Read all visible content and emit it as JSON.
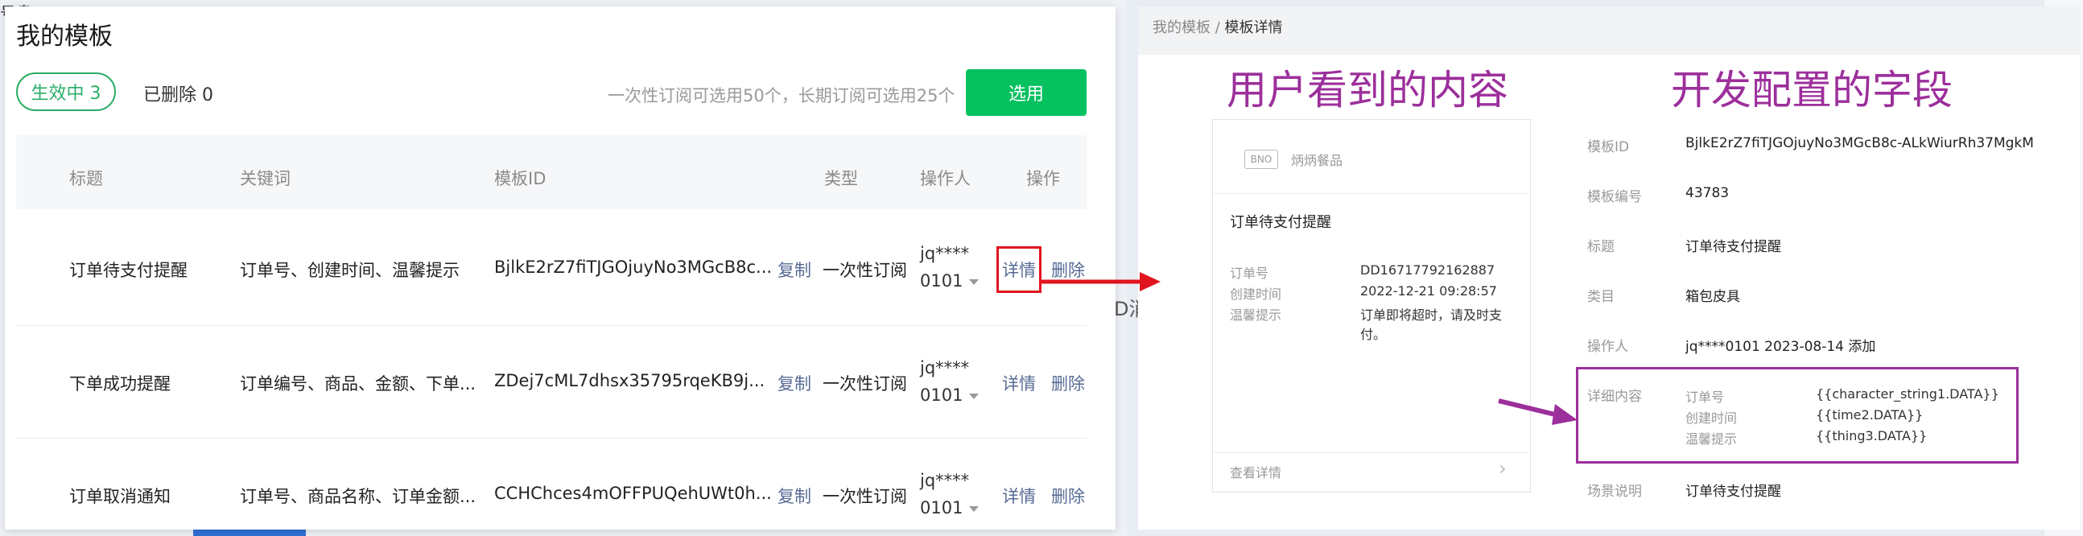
{
  "left": {
    "title": "我的模板",
    "tabs": {
      "active": "生效中  3",
      "deleted": "已删除  0"
    },
    "note": "一次性订阅可选用50个，长期订阅可选用25个",
    "select_button": "选用",
    "columns": [
      "标题",
      "关键词",
      "模板ID",
      "类型",
      "操作人",
      "操作"
    ],
    "rows": [
      {
        "title": "订单待支付提醒",
        "keywords": "订单号、创建时间、温馨提示",
        "template_id": "BjlkE2rZ7fiTJGOjuyNo3MGcB8c...",
        "copy": "复制",
        "type": "一次性订阅",
        "operator_line1": "jq****",
        "operator_line2": "0101",
        "detail": "详情",
        "delete": "删除"
      },
      {
        "title": "下单成功提醒",
        "keywords": "订单编号、商品、金额、下单...",
        "template_id": "ZDej7cML7dhsx35795rqeKB9j...",
        "copy": "复制",
        "type": "一次性订阅",
        "operator_line1": "jq****",
        "operator_line2": "0101",
        "detail": "详情",
        "delete": "删除"
      },
      {
        "title": "订单取消通知",
        "keywords": "订单号、商品名称、订单金额...",
        "template_id": "CCHChces4mOFFPUQehUWt0h...",
        "copy": "复制",
        "type": "一次性订阅",
        "operator_line1": "jq****",
        "operator_line2": "0101",
        "detail": "详情",
        "delete": "删除"
      }
    ],
    "bg_fragments": {
      "a": "D消",
      "b": "单",
      "c": "号盘"
    }
  },
  "right": {
    "breadcrumb": {
      "parent": "我的模板 /",
      "current": "模板详情"
    },
    "heading_user": "用户看到的内容",
    "heading_dev": "开发配置的字段",
    "card": {
      "logo": "BNO",
      "shop": "炳炳餐品",
      "title": "订单待支付提醒",
      "fields": [
        {
          "label": "订单号",
          "value": "DD16717792162887"
        },
        {
          "label": "创建时间",
          "value": "2022-12-21 09:28:57"
        },
        {
          "label": "温馨提示",
          "value_line1": "订单即将超时，请及时支",
          "value_line2": "付。"
        }
      ],
      "footer": "查看详情"
    },
    "info": {
      "template_id_label": "模板ID",
      "template_id": "BjlkE2rZ7fiTJGOjuyNo3MGcB8c-ALkWiurRh37MgkM",
      "number_label": "模板编号",
      "number": "43783",
      "title_label": "标题",
      "title": "订单待支付提醒",
      "category_label": "类目",
      "category": "箱包皮具",
      "operator_label": "操作人",
      "operator": "jq****0101 2023-08-14 添加",
      "detail_label": "详细内容",
      "details": [
        {
          "label": "订单号",
          "value": "{{character_string1.DATA}}"
        },
        {
          "label": "创建时间",
          "value": "{{time2.DATA}}"
        },
        {
          "label": "温馨提示",
          "value": "{{thing3.DATA}}"
        }
      ],
      "scene_label": "场景说明",
      "scene": "订单待支付提醒"
    }
  },
  "colors": {
    "green": "#07c160",
    "link": "#576b95",
    "annotation_red": "#e0141e",
    "annotation_purple": "#9c2f9b"
  }
}
